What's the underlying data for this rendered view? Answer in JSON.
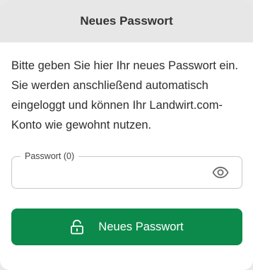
{
  "header": {
    "title": "Neues Passwort"
  },
  "description": "Bitte geben Sie hier Ihr neues Passwort ein. Sie werden anschließend automatisch eingeloggt und können Ihr Landwirt.com-Konto wie gewohnt nutzen.",
  "password_field": {
    "label": "Passwort (0)",
    "value": "",
    "toggle_icon": "eye-icon"
  },
  "submit_button": {
    "label": "Neues Passwort",
    "icon": "unlock-icon"
  },
  "colors": {
    "header_background": "#e7e7e7",
    "button_background": "#0c8a4b",
    "page_background": "#e9e9e9"
  }
}
